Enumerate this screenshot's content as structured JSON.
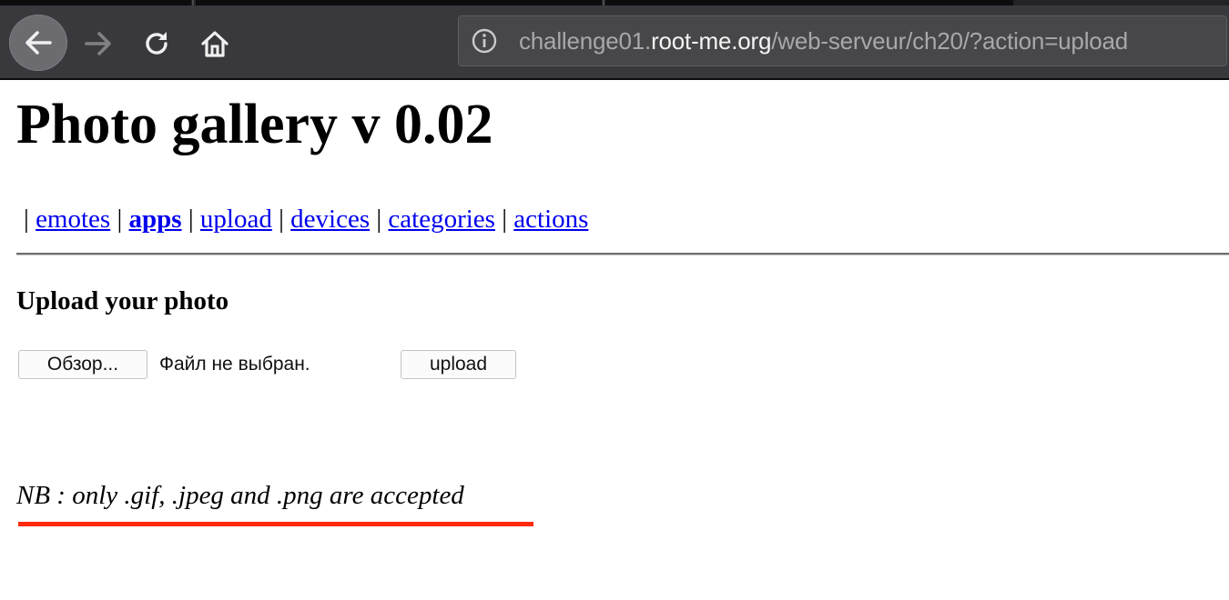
{
  "browser": {
    "url_scheme_host_prefix": "challenge01.",
    "url_host": "root-me.org",
    "url_path": "/web-serveur/ch20/?action=upload",
    "icons": {
      "back": "arrow-left-icon",
      "forward": "arrow-right-icon",
      "reload": "reload-icon",
      "home": "home-icon",
      "site_info": "info-circle-icon"
    }
  },
  "page": {
    "title": "Photo gallery v 0.02",
    "menu": {
      "separator": "|",
      "items": [
        {
          "label": "emotes",
          "active": false
        },
        {
          "label": "apps",
          "active": true
        },
        {
          "label": "upload",
          "active": false
        },
        {
          "label": "devices",
          "active": false
        },
        {
          "label": "categories",
          "active": false
        },
        {
          "label": "actions",
          "active": false
        }
      ]
    },
    "upload_heading": "Upload your photo",
    "form": {
      "browse_label": "Обзор...",
      "file_status": "Файл не выбран.",
      "submit_label": "upload"
    },
    "note": "NB : only .gif, .jpeg and .png are accepted"
  },
  "colors": {
    "link": "#0000ee",
    "annotation_underline": "#ff2a0e",
    "toolbar_bg": "#38383d"
  }
}
